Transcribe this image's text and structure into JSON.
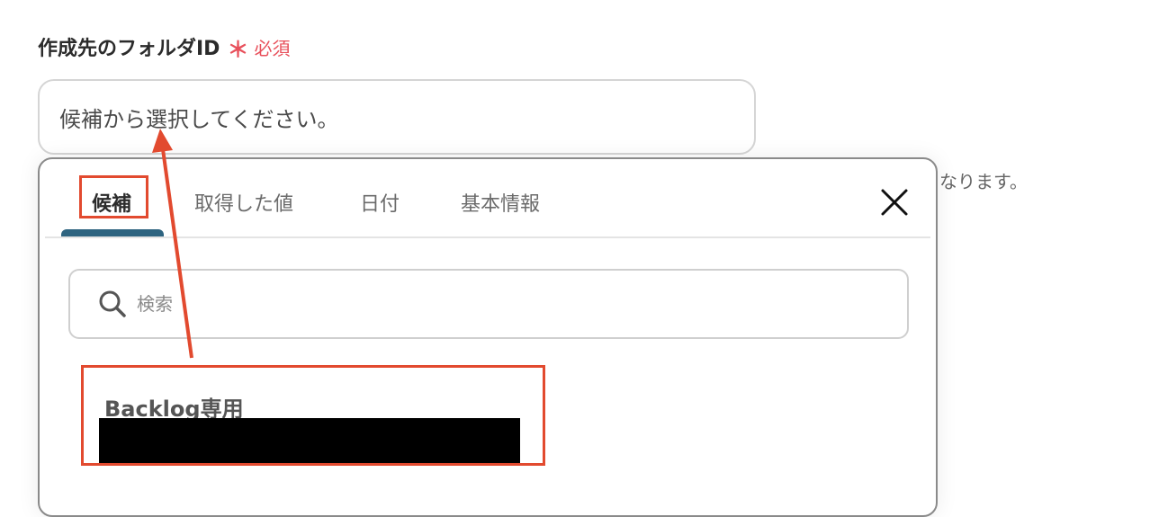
{
  "field": {
    "label": "作成先のフォルダID",
    "required_mark": "＊",
    "required_text": "必須",
    "placeholder": "候補から選択してください。",
    "helper_tail": "なります。"
  },
  "popup": {
    "tabs": [
      {
        "label": "候補",
        "active": true
      },
      {
        "label": "取得した値",
        "active": false
      },
      {
        "label": "日付",
        "active": false
      },
      {
        "label": "基本情報",
        "active": false
      }
    ],
    "search_placeholder": "検索",
    "options": [
      {
        "title": "Backlog専用",
        "subtitle_redacted": true
      }
    ]
  },
  "colors": {
    "required": "#e8505b",
    "active_tab_underline": "#2e6480",
    "annotation": "#e24a2f"
  },
  "icons": {
    "close": "close-icon",
    "search": "search-icon"
  }
}
